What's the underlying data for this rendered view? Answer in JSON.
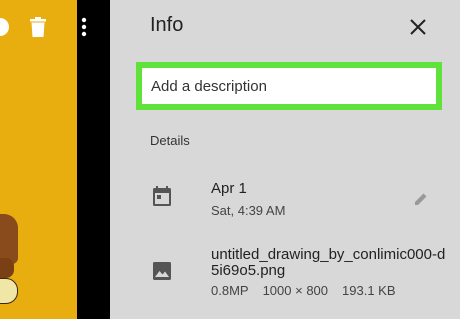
{
  "viewer": {
    "icons": [
      "info-icon",
      "trash-icon",
      "more-vert-icon"
    ]
  },
  "panel": {
    "title": "Info",
    "close_icon": "close-icon",
    "description": {
      "placeholder": "Add a description",
      "value": ""
    },
    "details_label": "Details",
    "date": {
      "icon": "calendar-icon",
      "primary": "Apr 1",
      "secondary": "Sat, 4:39 AM",
      "edit_icon": "pencil-icon"
    },
    "file": {
      "icon": "image-icon",
      "name": "untitled_drawing_by_conlimic000-d5i69o5.png",
      "megapixels": "0.8MP",
      "dimensions": "1000 × 800",
      "size": "193.1 KB"
    }
  },
  "colors": {
    "highlight": "#5fe33a",
    "photo": "#e8ae10",
    "panel_bg": "#d8d8d8"
  }
}
